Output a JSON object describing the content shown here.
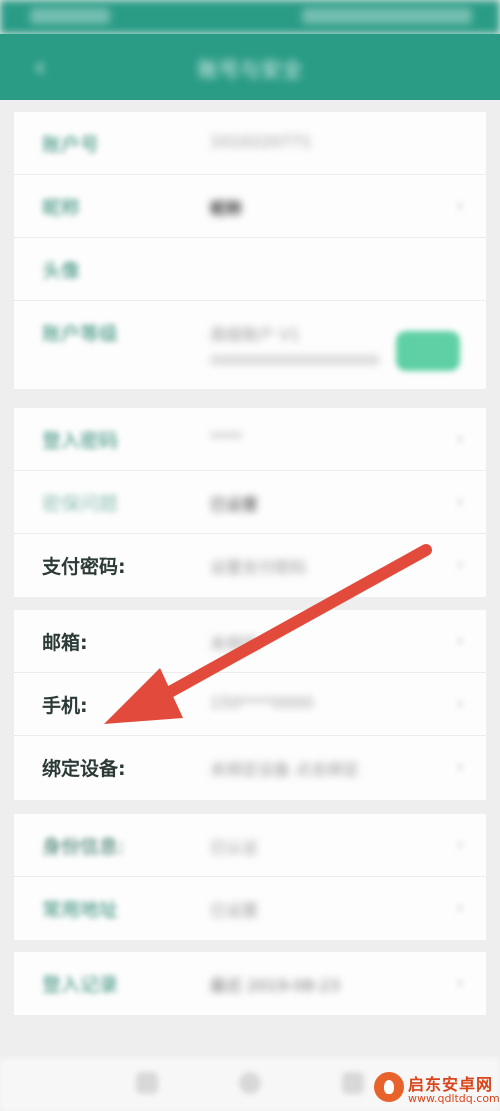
{
  "status_bar": {
    "left": "中国移动",
    "right": "100% 12:00"
  },
  "header": {
    "back_icon": "back-arrow-icon",
    "title": "账号与安全"
  },
  "sections": [
    {
      "rows": [
        {
          "label": "账户号",
          "value": "1010220771",
          "chevron": false
        },
        {
          "label": "昵称",
          "value": "昵称",
          "chevron": true
        },
        {
          "label": "头像",
          "value": "",
          "chevron": false
        },
        {
          "label": "账户等级",
          "value": "高级账户 V1",
          "sub": "",
          "chevron": false
        }
      ]
    },
    {
      "rows": [
        {
          "label": "登入密码",
          "value": "****",
          "chevron": true
        },
        {
          "label": "密保问题",
          "value": "已设置",
          "chevron": true
        },
        {
          "label": "支付密码:",
          "value": "设置支付密码",
          "chevron": true
        }
      ]
    },
    {
      "rows": [
        {
          "label": "邮箱:",
          "value": "未绑定",
          "chevron": true
        },
        {
          "label": "手机:",
          "value": "150****0000",
          "chevron": true
        },
        {
          "label": "绑定设备:",
          "value": "未绑定设备 点击绑定",
          "chevron": true
        }
      ]
    },
    {
      "rows": [
        {
          "label": "身份信息:",
          "value": "已认证",
          "chevron": true
        },
        {
          "label": "常用地址",
          "value": "已设置",
          "chevron": true
        }
      ]
    },
    {
      "rows": [
        {
          "label": "登入记录",
          "value": "最近 2019-08-23",
          "chevron": true
        }
      ]
    }
  ],
  "watermark": {
    "name": "启东安卓网",
    "url": "www.qdltdq.com"
  },
  "colors": {
    "header": "#2a9c86",
    "arrow": "#e24b3b",
    "label": "#2f8a76",
    "accent_pill": "#5fd0a5"
  }
}
